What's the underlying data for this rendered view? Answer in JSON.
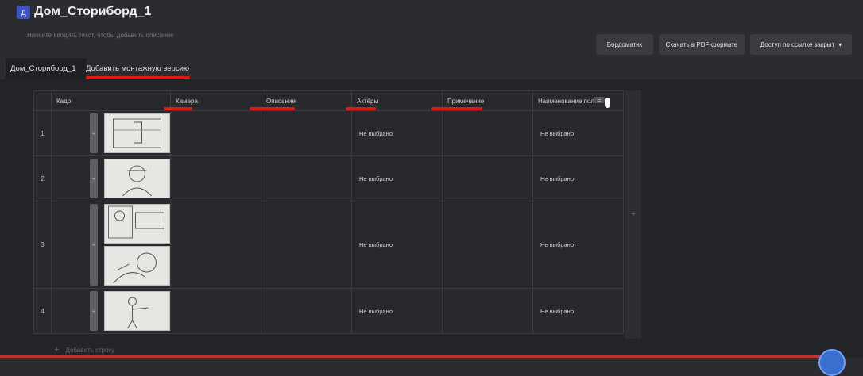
{
  "header": {
    "icon_letter": "Д",
    "title": "Дом_Сториборд_1",
    "description_placeholder": "Начните вводить текст, чтобы добавить описание"
  },
  "toolbar": {
    "bordomatic": "Бордоматик",
    "download_pdf": "Скачать в PDF-формате",
    "access": "Доступ по ссылке закрыт"
  },
  "tabs": {
    "active": "Дом_Сториборд_1",
    "add_version": "Добавить монтажную версию"
  },
  "table": {
    "columns": [
      "Кадр",
      "Камера",
      "Описание",
      "Актёры",
      "Примечание",
      "Наименование пол..."
    ],
    "rows": [
      {
        "num": "1",
        "actors": "Не выбрано",
        "custom": "Не выбрано"
      },
      {
        "num": "2",
        "actors": "Не выбрано",
        "custom": "Не выбрано"
      },
      {
        "num": "3",
        "actors": "Не выбрано",
        "custom": "Не выбрано"
      },
      {
        "num": "4",
        "actors": "Не выбрано",
        "custom": "Не выбрано"
      }
    ]
  },
  "add_row": "Добавить строку",
  "colors": {
    "accent": "#3f51c8",
    "highlight": "#e01818"
  }
}
